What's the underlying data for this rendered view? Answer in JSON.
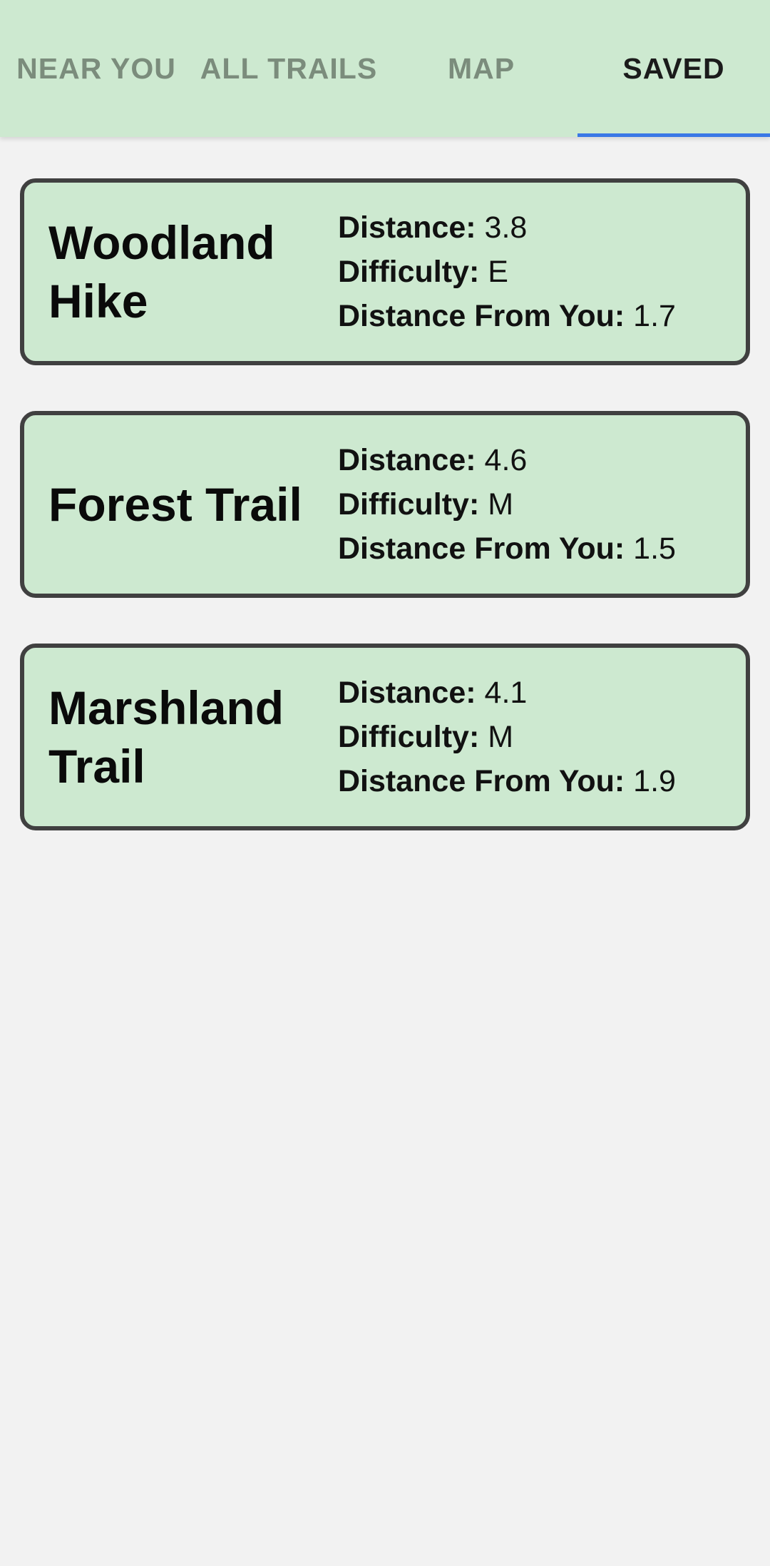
{
  "tabs": [
    {
      "label": "NEAR YOU",
      "active": false
    },
    {
      "label": "ALL TRAILS",
      "active": false
    },
    {
      "label": "MAP",
      "active": false
    },
    {
      "label": "SAVED",
      "active": true
    }
  ],
  "labels": {
    "distance": "Distance:",
    "difficulty": "Difficulty:",
    "distance_from_you": "Distance From You:"
  },
  "trails": [
    {
      "name": "Woodland Hike",
      "distance": "3.8",
      "difficulty": "E",
      "distance_from_you": "1.7"
    },
    {
      "name": "Forest Trail",
      "distance": "4.6",
      "difficulty": "M",
      "distance_from_you": "1.5"
    },
    {
      "name": "Marshland Trail",
      "distance": "4.1",
      "difficulty": "M",
      "distance_from_you": "1.9"
    }
  ],
  "colors": {
    "header_bg": "#cde9d0",
    "card_bg": "#cde9d0",
    "card_border": "#404040",
    "page_bg": "#f2f2f2",
    "active_indicator": "#3a78e6",
    "inactive_tab_text": "#7b8c7c",
    "active_tab_text": "#1b1b1b"
  }
}
